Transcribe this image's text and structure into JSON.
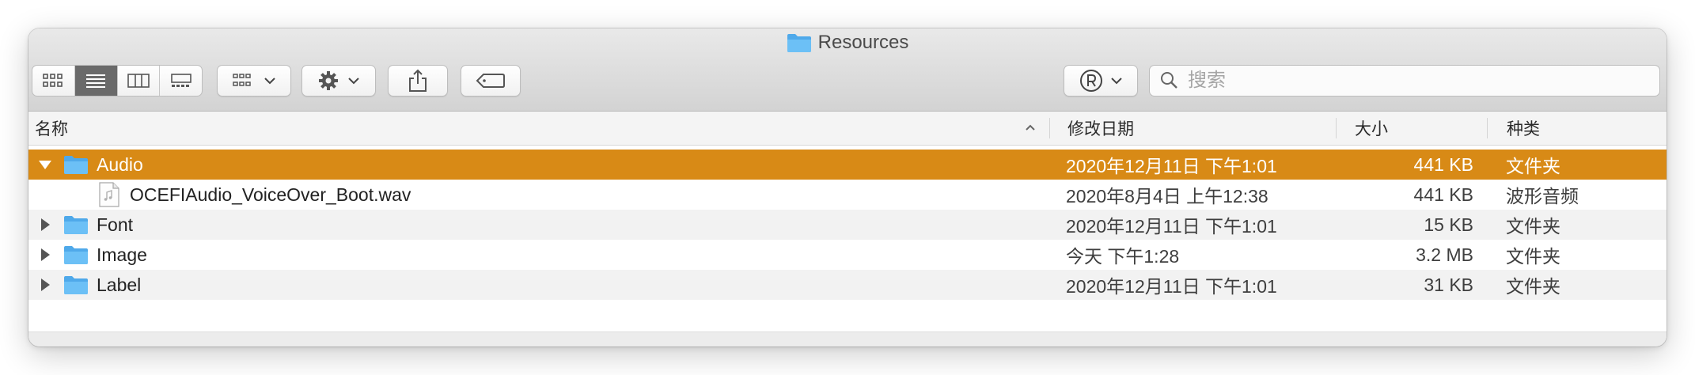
{
  "window": {
    "title": "Resources"
  },
  "toolbar": {
    "view_modes": [
      "icon-view",
      "list-view",
      "column-view",
      "gallery-view"
    ],
    "active_view": "list-view",
    "search_placeholder": "搜索"
  },
  "columns": {
    "name": "名称",
    "date_modified": "修改日期",
    "size": "大小",
    "kind": "种类"
  },
  "rows": [
    {
      "name": "Audio",
      "date": "2020年12月11日 下午1:01",
      "size": "441 KB",
      "kind": "文件夹",
      "type": "folder",
      "expanded": true,
      "selected": true
    },
    {
      "name": "OCEFIAudio_VoiceOver_Boot.wav",
      "date": "2020年8月4日 上午12:38",
      "size": "441 KB",
      "kind": "波形音频",
      "type": "file",
      "indent": 1
    },
    {
      "name": "Font",
      "date": "2020年12月11日 下午1:01",
      "size": "15 KB",
      "kind": "文件夹",
      "type": "folder"
    },
    {
      "name": "Image",
      "date": "今天 下午1:28",
      "size": "3.2 MB",
      "kind": "文件夹",
      "type": "folder"
    },
    {
      "name": "Label",
      "date": "2020年12月11日 下午1:01",
      "size": "31 KB",
      "kind": "文件夹",
      "type": "folder"
    }
  ],
  "colors": {
    "selection": "#d88a16",
    "folder": "#5fb7f1"
  }
}
